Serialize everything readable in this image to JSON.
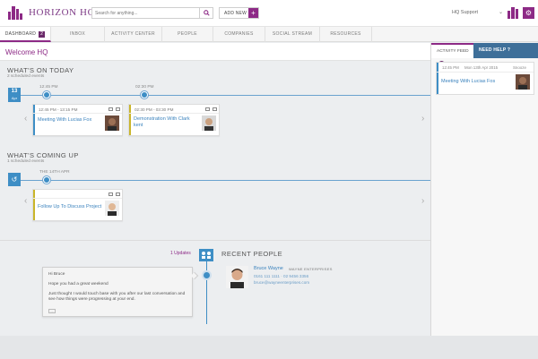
{
  "header": {
    "logo_text": "HORIZON HQ",
    "search_placeholder": "Search for anything...",
    "add_new_label": "ADD NEW",
    "add_new_plus": "+",
    "support_label": "HQ Support"
  },
  "nav": {
    "items": [
      {
        "label": "DASHBOARD",
        "badge": "2"
      },
      {
        "label": "INBOX"
      },
      {
        "label": "ACTIVITY CENTER"
      },
      {
        "label": "PEOPLE"
      },
      {
        "label": "COMPANIES"
      },
      {
        "label": "SOCIAL STREAM"
      },
      {
        "label": "RESOURCES"
      }
    ]
  },
  "main": {
    "welcome": "Welcome HQ",
    "today": {
      "title": "WHAT'S ON TODAY",
      "subtitle": "2 scheduled events",
      "date_day": "13",
      "date_month": "Apr",
      "markers": [
        "12:45 PM",
        "02:30 PM"
      ],
      "events": [
        {
          "time": "12:45 PM - 13:15 PM",
          "title": "Meeting With Lucias Fox",
          "color": "#3e8ec5"
        },
        {
          "time": "02:30 PM - 03:30 PM",
          "title": "Demonstration With Clark kent",
          "color": "#c9b52a"
        }
      ]
    },
    "coming": {
      "title": "WHAT'S COMING UP",
      "subtitle": "1 scheduled events",
      "marker": "THE 14TH APR",
      "events": [
        {
          "time": "",
          "title": "Follow Up To Discuss Project",
          "color": "#c9b52a"
        }
      ]
    },
    "updates_label": "1 Updates",
    "recent_title": "RECENT PEOPLE",
    "note": {
      "greeting": "Hi Bruce",
      "line1": "Hope you had a great weekend",
      "line2": "Just thought I would touch base with you after our last conversation and see how things were progressing at your end.",
      "more": "..."
    },
    "person": {
      "name": "Bruce Wayne",
      "company": "WAYNE ENTERPRISES",
      "phones": "0161 111 1111  ·  02 9456 3356",
      "email": "bruce@wayneenterprises.com"
    }
  },
  "right_panel": {
    "feed_tab": "ACTIVITY FEED",
    "feed_count": "1",
    "help_tab": "NEED HELP ?",
    "feed_item": {
      "time": "12:45 PM",
      "date": "Mon 13th Apr 2015",
      "duration": "Snooze",
      "title": "Meeting With Lucias Fos"
    }
  },
  "colors": {
    "brand": "#8d2a86",
    "accent": "#3e8ec5",
    "link": "#3a82bd"
  }
}
